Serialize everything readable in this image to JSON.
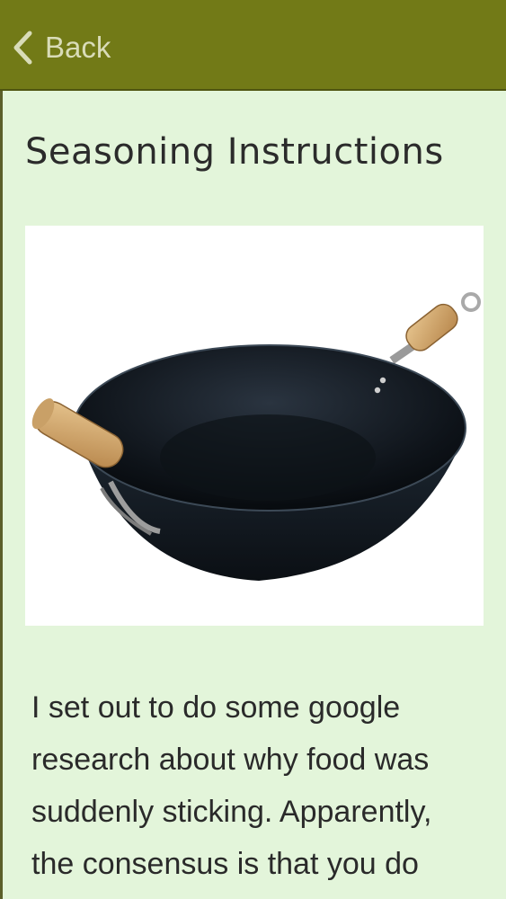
{
  "nav": {
    "back_label": "Back",
    "back_icon": "chevron-left-icon"
  },
  "article": {
    "title": "Seasoning Instructions",
    "image_subject": "wok",
    "body": "I set out to do some google research about why food was suddenly sticking. Apparently, the consensus is that you do"
  },
  "colors": {
    "topbar": "#727a17",
    "background": "#e3f5da",
    "title": "#2b2b2b",
    "body_text": "#2a2a2a"
  }
}
